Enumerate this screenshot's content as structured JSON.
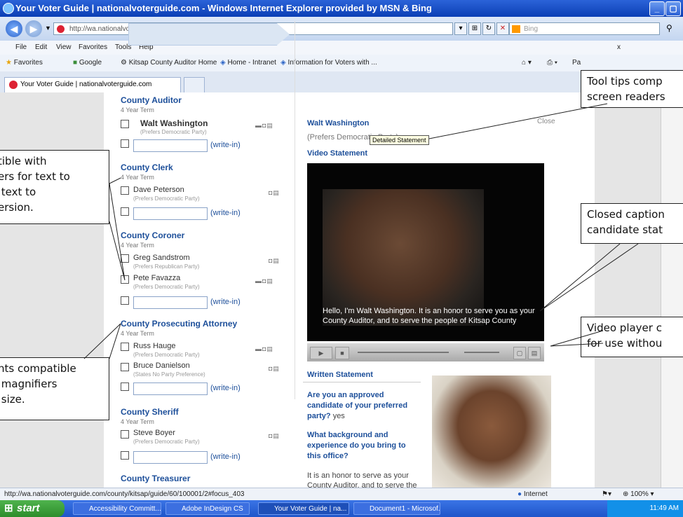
{
  "window": {
    "title": "Your Voter Guide | nationalvoterguide.com - Windows Internet Explorer provided by MSN & Bing"
  },
  "address": {
    "url": "http://wa.nationalvoterguide.com/county/kitsap/guide/60/100001/2",
    "search_placeholder": "Bing"
  },
  "menu": [
    "File",
    "Edit",
    "View",
    "Favorites",
    "Tools",
    "Help"
  ],
  "favorites": {
    "label": "Favorites",
    "items": [
      "Google",
      "Kitsap County Auditor Home",
      "Home - Intranet",
      "Information for Voters with ..."
    ],
    "page_label": "Pa"
  },
  "tab": {
    "label": "Your Voter Guide | nationalvoterguide.com"
  },
  "guide": {
    "write_in": "(write-in)",
    "races": [
      {
        "title": "County Auditor",
        "term": "4 Year Term",
        "candidates": [
          {
            "name": "Walt Washington",
            "party": "(Prefers Democratic Party)"
          }
        ]
      },
      {
        "title": "County Clerk",
        "term": "4 Year Term",
        "candidates": [
          {
            "name": "Dave Peterson",
            "party": "(Prefers Democratic Party)"
          }
        ]
      },
      {
        "title": "County Coroner",
        "term": "4 Year Term",
        "candidates": [
          {
            "name": "Greg Sandstrom",
            "party": "(Prefers Republican Party)"
          },
          {
            "name": "Pete Favazza",
            "party": "(Prefers Democratic Party)"
          }
        ]
      },
      {
        "title": "County Prosecuting Attorney",
        "term": "4 Year Term",
        "candidates": [
          {
            "name": "Russ Hauge",
            "party": "(Prefers Democratic Party)"
          },
          {
            "name": "Bruce Danielson",
            "party": "(States No Party Preference)"
          }
        ]
      },
      {
        "title": "County Sheriff",
        "term": "4 Year Term",
        "candidates": [
          {
            "name": "Steve Boyer",
            "party": "(Prefers Democratic Party)"
          }
        ]
      },
      {
        "title": "County Treasurer",
        "term": ""
      }
    ]
  },
  "detail": {
    "name": "Walt Washington",
    "party": "(Prefers Democratic Party)",
    "close": "Close",
    "tooltip": "Detailed Statement",
    "video_heading": "Video Statement",
    "caption": "Hello, I'm Walt Washington. It is an honor to serve you as your County Auditor, and to serve the people of Kitsap County",
    "written_heading": "Written Statement",
    "q1": "Are you an approved candidate of your preferred party?",
    "a1": "yes",
    "q2": "What background and experience do you bring to this office?",
    "a2": "It is an honor to serve as your County Auditor, and to serve the"
  },
  "callouts": {
    "tooltips": "Tool tips comp\nscreen readers",
    "text_version": "tible with\ners for text to\n text to\nersion.",
    "captions": "Closed caption\ncandidate stat",
    "video_player": "Video player c\nfor use withou",
    "magnifiers": "nts compatible\n magnifiers\n size."
  },
  "status": {
    "url": "http://wa.nationalvoterguide.com/county/kitsap/guide/60/100001/2#focus_403",
    "zone": "Internet",
    "zoom": "100%"
  },
  "taskbar": {
    "start": "start",
    "tasks": [
      "Accessibility Committ...",
      "Adobe InDesign CS",
      "Your Voter Guide | na...",
      "Document1 - Microsof..."
    ],
    "time": "11:49 AM"
  }
}
